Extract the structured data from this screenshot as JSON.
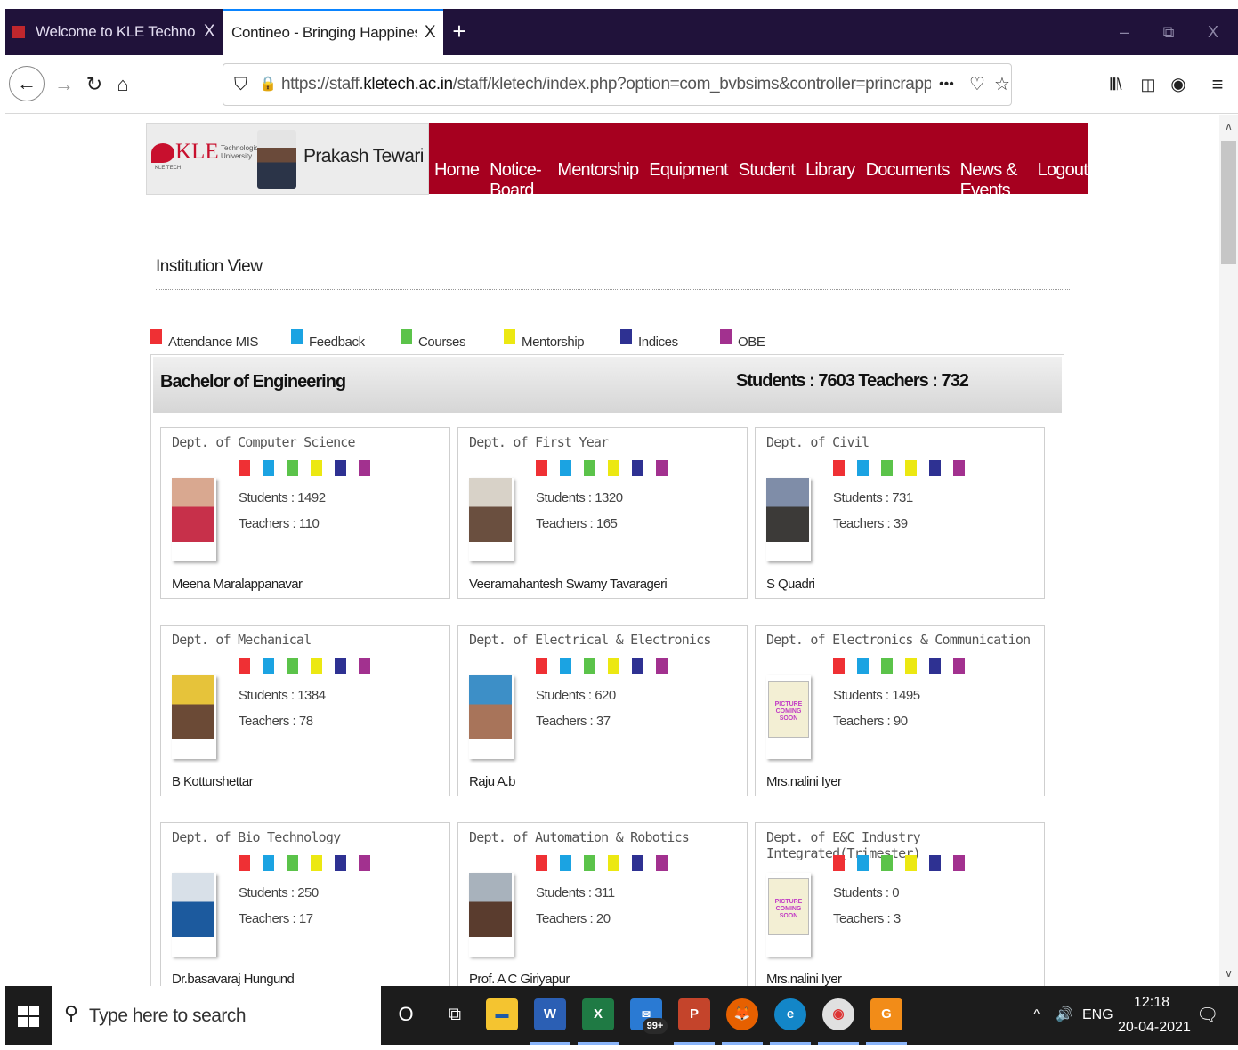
{
  "browser": {
    "tabs": [
      {
        "title": "Welcome to KLE Technological",
        "active": false
      },
      {
        "title": "Contineo - Bringing Happiness to w",
        "active": true
      }
    ],
    "new_tab_icon": "+",
    "tab_close_icon": "X",
    "window_controls": [
      "–",
      "⧉",
      "X"
    ],
    "url_prefix": "https://staff.",
    "url_domain": "kletech.ac.in",
    "url_rest": "/staff/kletech/index.php?option=com_bvbsims&controller=princrapper&task=princrap",
    "url_more": "•••"
  },
  "header": {
    "logo_text": "KLE",
    "logo_sub": "Technological University",
    "logo_tag": "Creating Value Leveraging Knowledge",
    "logo_small": "KLE TECH",
    "user_name": "Prakash Tewari",
    "nav": [
      "Home",
      "Notice-Board",
      "Mentorship",
      "Equipment",
      "Student",
      "Library",
      "Documents",
      "News & Events",
      "Logout"
    ]
  },
  "institution_title": "Institution View",
  "legend": [
    {
      "label": "Attendance MIS",
      "color": "#ef3034"
    },
    {
      "label": "Feedback",
      "color": "#1ba3e2"
    },
    {
      "label": "Courses",
      "color": "#5bc34a"
    },
    {
      "label": "Mentorship",
      "color": "#ece812"
    },
    {
      "label": "Indices",
      "color": "#2e3192"
    },
    {
      "label": "OBE",
      "color": "#a2318f"
    }
  ],
  "program": {
    "name": "Bachelor of Engineering",
    "totals": "Students : 7603   Teachers : 732"
  },
  "departments": [
    {
      "name": "Dept. of Computer Science",
      "students": "Students : 1492",
      "teachers": "Teachers : 110",
      "head": "Meena Maralappanavar",
      "photo": "person"
    },
    {
      "name": "Dept. of First Year",
      "students": "Students : 1320",
      "teachers": "Teachers : 165",
      "head": "Veeramahantesh Swamy Tavarageri",
      "photo": "person"
    },
    {
      "name": "Dept. of Civil",
      "students": "Students : 731",
      "teachers": "Teachers : 39",
      "head": "S Quadri",
      "photo": "person"
    },
    {
      "name": "Dept. of Mechanical",
      "students": "Students : 1384",
      "teachers": "Teachers : 78",
      "head": "B Kotturshettar",
      "photo": "person"
    },
    {
      "name": "Dept. of Electrical & Electronics",
      "students": "Students : 620",
      "teachers": "Teachers : 37",
      "head": "Raju A.b",
      "photo": "person"
    },
    {
      "name": "Dept. of Electronics & Communication",
      "students": "Students : 1495",
      "teachers": "Teachers : 90",
      "head": "Mrs.nalini Iyer",
      "photo": "placeholder"
    },
    {
      "name": "Dept. of Bio Technology",
      "students": "Students : 250",
      "teachers": "Teachers : 17",
      "head": "Dr.basavaraj Hungund",
      "photo": "person"
    },
    {
      "name": "Dept. of Automation & Robotics",
      "students": "Students : 311",
      "teachers": "Teachers : 20",
      "head": "Prof. A C Giriyapur",
      "photo": "person"
    },
    {
      "name": "Dept. of E&C Industry Integrated(Trimester)",
      "students": "Students : 0",
      "teachers": "Teachers : 3",
      "head": "Mrs.nalini Iyer",
      "photo": "placeholder"
    }
  ],
  "placeholder_text": "PICTURE COMING SOON",
  "taskbar": {
    "search_placeholder": "Type here to search",
    "mail_badge": "99+",
    "language": "ENG",
    "time": "12:18",
    "date": "20-04-2021"
  }
}
